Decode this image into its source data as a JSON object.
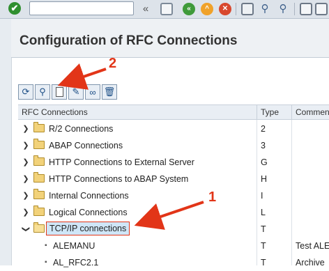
{
  "toolbar": {
    "command_value": "",
    "back_glyph": "«"
  },
  "page": {
    "title": "Configuration of RFC Connections"
  },
  "callouts": {
    "one": "1",
    "two": "2"
  },
  "grid": {
    "headers": [
      "RFC Connections",
      "Type",
      "Comment"
    ],
    "folders": [
      {
        "label": "R/2 Connections",
        "type": "2"
      },
      {
        "label": "ABAP Connections",
        "type": "3"
      },
      {
        "label": "HTTP Connections to External Server",
        "type": "G"
      },
      {
        "label": "HTTP Connections to ABAP System",
        "type": "H"
      },
      {
        "label": "Internal Connections",
        "type": "I"
      },
      {
        "label": "Logical Connections",
        "type": "L"
      },
      {
        "label": "TCP/IP connections",
        "type": "T"
      }
    ],
    "children": [
      {
        "label": "ALEMANU",
        "type": "T",
        "comment": "Test ALE"
      },
      {
        "label": "AL_RFC2.1",
        "type": "T",
        "comment": "Archive"
      }
    ]
  },
  "colors": {
    "accent_red": "#e23518",
    "folder": "#f2d27a",
    "selection": "#cfe6f7"
  }
}
